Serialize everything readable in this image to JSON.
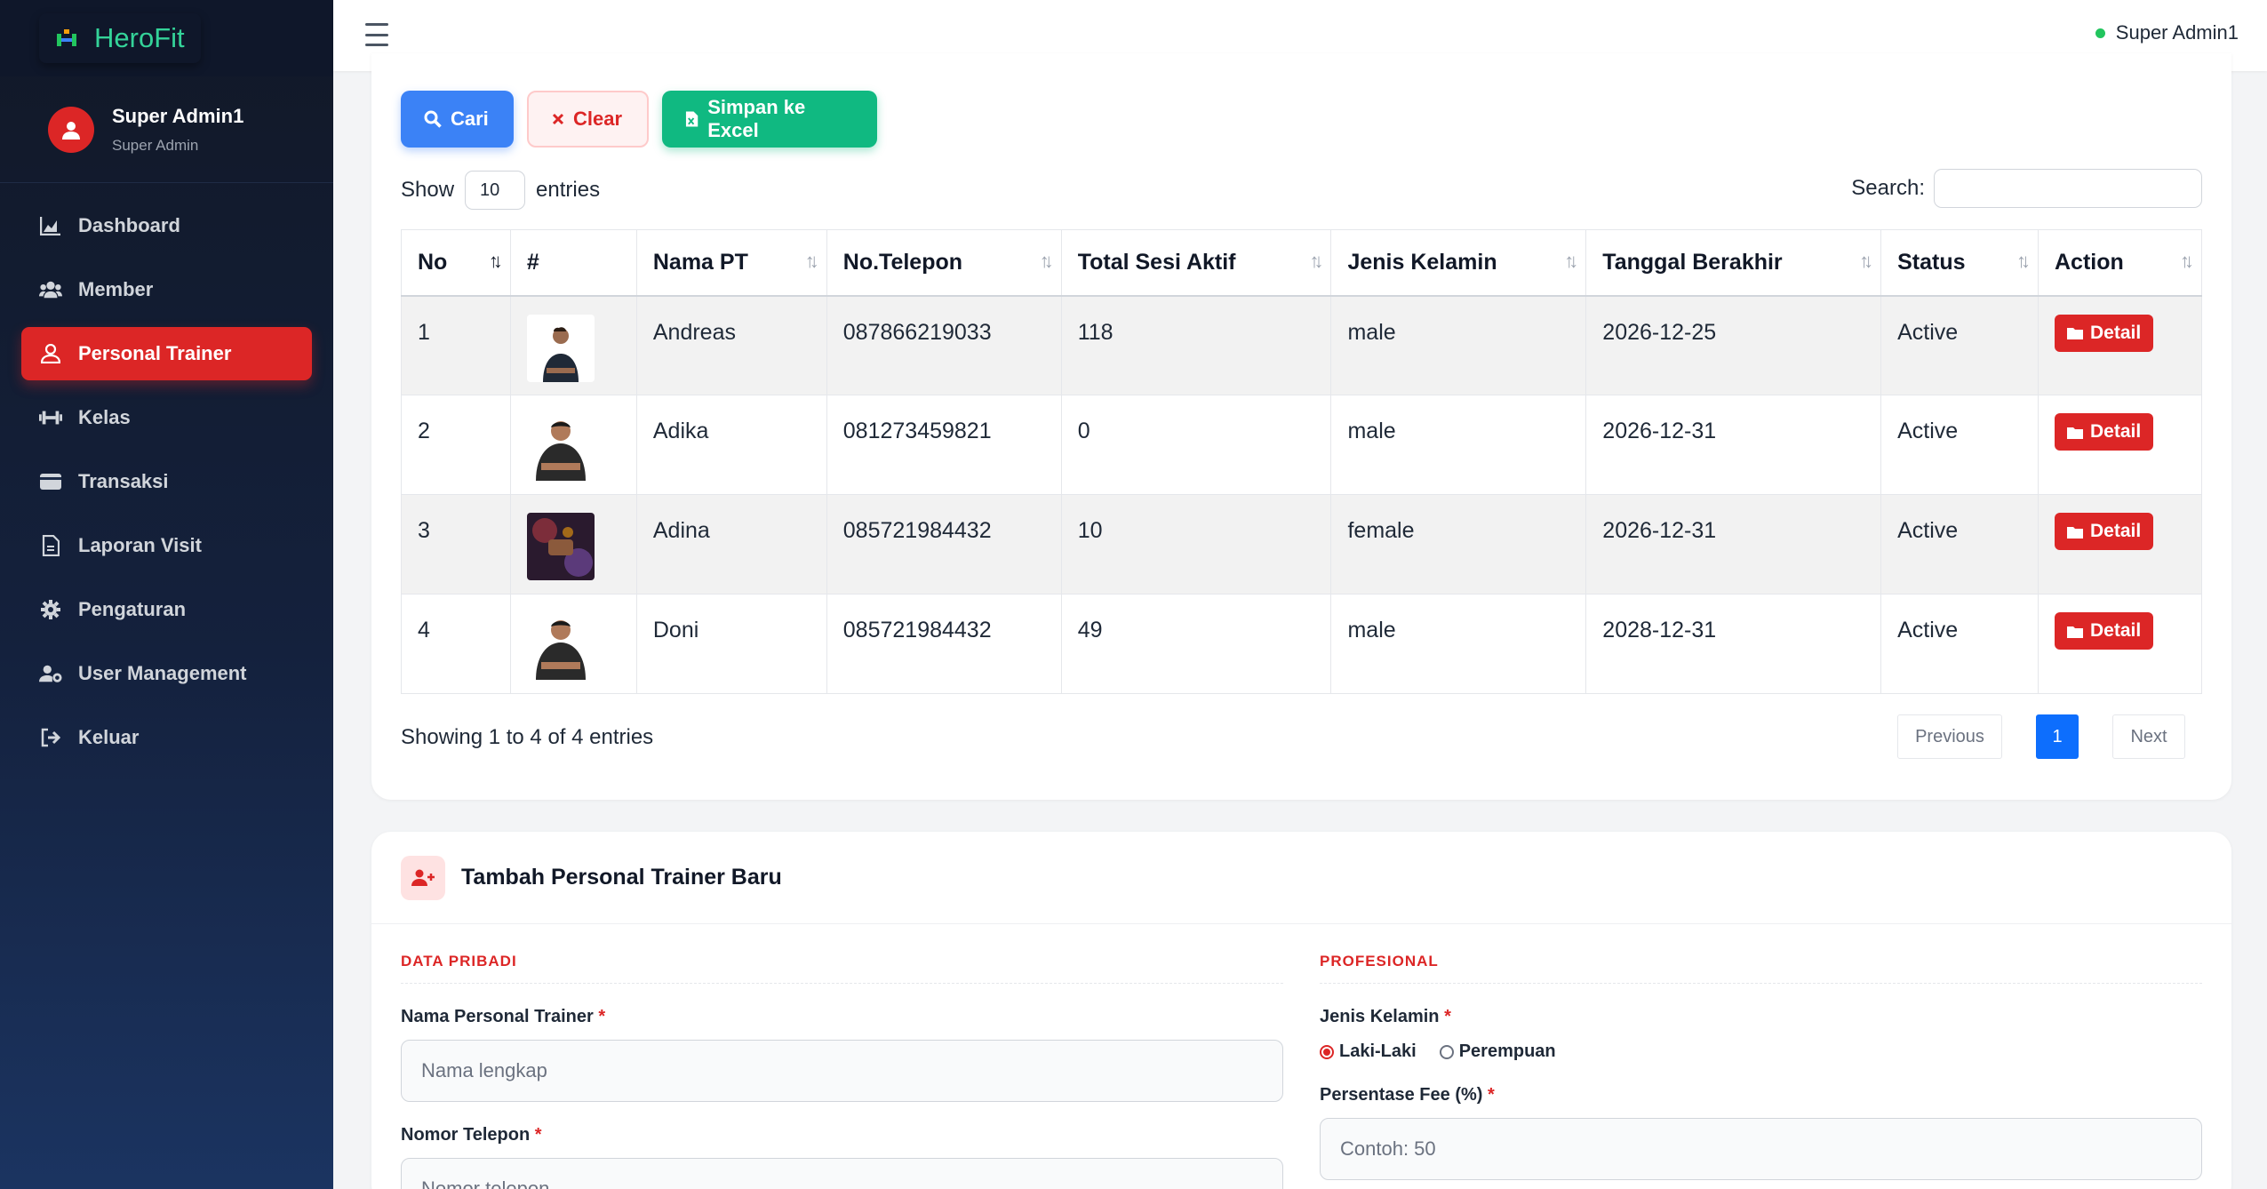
{
  "brand": {
    "name": "HeroFit"
  },
  "sidebar_user": {
    "name": "Super Admin1",
    "role": "Super Admin"
  },
  "nav": [
    {
      "label": "Dashboard",
      "icon": "chart-area-icon"
    },
    {
      "label": "Member",
      "icon": "users-icon"
    },
    {
      "label": "Personal Trainer",
      "icon": "user-icon",
      "active": true
    },
    {
      "label": "Kelas",
      "icon": "dumbbell-icon"
    },
    {
      "label": "Transaksi",
      "icon": "wallet-icon"
    },
    {
      "label": "Laporan Visit",
      "icon": "file-icon"
    },
    {
      "label": "Pengaturan",
      "icon": "gear-icon"
    },
    {
      "label": "User Management",
      "icon": "user-gear-icon"
    },
    {
      "label": "Keluar",
      "icon": "sign-out-icon"
    }
  ],
  "topbar": {
    "user": "Super Admin1",
    "status_color": "#22c55e"
  },
  "toolbar": {
    "search_label": "Cari",
    "clear_label": "Clear",
    "excel_label": "Simpan ke Excel"
  },
  "table_controls": {
    "show_prefix": "Show",
    "page_length": "10",
    "show_suffix": "entries",
    "search_label": "Search:",
    "search_value": ""
  },
  "table": {
    "columns": [
      "No",
      "#",
      "Nama PT",
      "No.Telepon",
      "Total Sesi Aktif",
      "Jenis Kelamin",
      "Tanggal Berakhir",
      "Status",
      "Action"
    ],
    "rows": [
      {
        "no": "1",
        "nama": "Andreas",
        "telepon": "087866219033",
        "sesi": "118",
        "jk": "male",
        "berakhir": "2026-12-25",
        "status": "Active",
        "action": "Detail"
      },
      {
        "no": "2",
        "nama": "Adika",
        "telepon": "081273459821",
        "sesi": "0",
        "jk": "male",
        "berakhir": "2026-12-31",
        "status": "Active",
        "action": "Detail"
      },
      {
        "no": "3",
        "nama": "Adina",
        "telepon": "085721984432",
        "sesi": "10",
        "jk": "female",
        "berakhir": "2026-12-31",
        "status": "Active",
        "action": "Detail"
      },
      {
        "no": "4",
        "nama": "Doni",
        "telepon": "085721984432",
        "sesi": "49",
        "jk": "male",
        "berakhir": "2028-12-31",
        "status": "Active",
        "action": "Detail"
      }
    ]
  },
  "pagination": {
    "info": "Showing 1 to 4 of 4 entries",
    "prev": "Previous",
    "current": "1",
    "next": "Next"
  },
  "form": {
    "title": "Tambah Personal Trainer Baru",
    "left_section": "DATA PRIBADI",
    "right_section": "PROFESIONAL",
    "name_label": "Nama Personal Trainer",
    "name_placeholder": "Nama lengkap",
    "phone_label": "Nomor Telepon",
    "phone_placeholder": "Nomor telepon",
    "gender_label": "Jenis Kelamin",
    "gender_male": "Laki-Laki",
    "gender_female": "Perempuan",
    "fee_label": "Persentase Fee (%)",
    "fee_placeholder": "Contoh: 50",
    "required_mark": "*"
  },
  "colors": {
    "accent": "#dc2626",
    "primary": "#3b82f6",
    "success": "#10b981",
    "pagination_active": "#0d6efd"
  }
}
